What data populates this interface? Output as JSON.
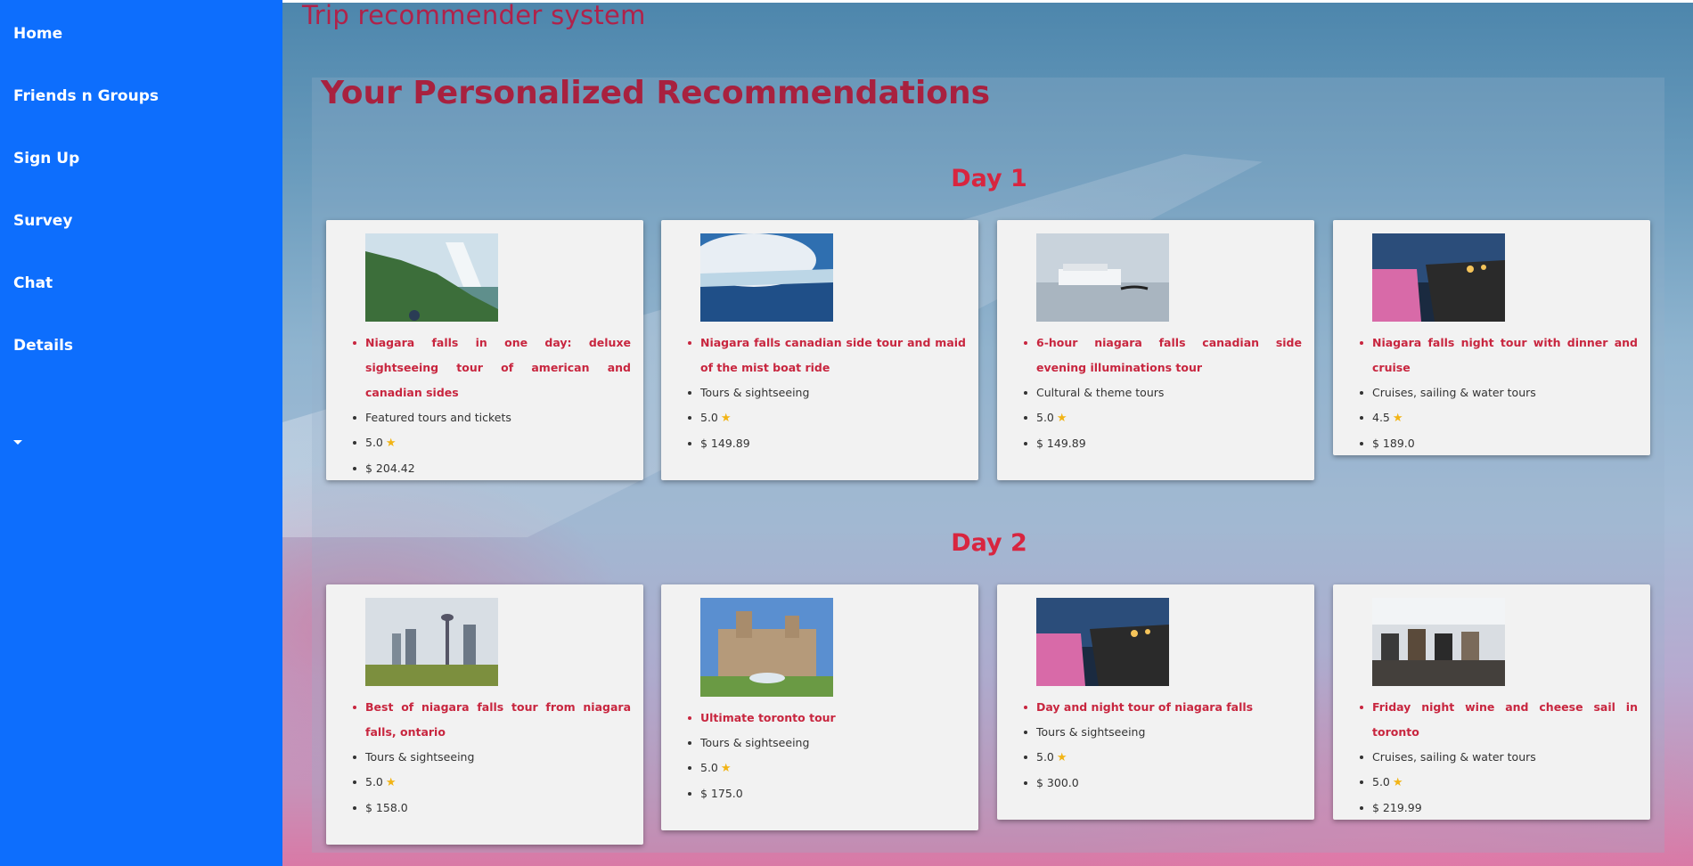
{
  "sidebar": {
    "items": [
      {
        "label": "Home"
      },
      {
        "label": "Friends n Groups"
      },
      {
        "label": "Sign Up"
      },
      {
        "label": "Survey"
      },
      {
        "label": "Chat"
      },
      {
        "label": "Details"
      }
    ],
    "dropdown_icon": "caret-down-icon"
  },
  "header": {
    "title": "Trip recommender system"
  },
  "main": {
    "heading": "Your Personalized Recommendations",
    "days": [
      {
        "label": "Day 1",
        "cards": [
          {
            "name": "Niagara falls in one day: deluxe sightseeing tour of american and canadian sides",
            "category": "Featured tours and tickets",
            "rating": "5.0",
            "price": "$ 204.42"
          },
          {
            "name": "Niagara falls canadian side tour and maid of the mist boat ride",
            "category": "Tours & sightseeing",
            "rating": "5.0",
            "price": "$ 149.89"
          },
          {
            "name": "6-hour niagara falls canadian side evening illuminations tour",
            "category": "Cultural & theme tours",
            "rating": "5.0",
            "price": "$ 149.89"
          },
          {
            "name": "Niagara falls night tour with dinner and cruise",
            "category": "Cruises, sailing & water tours",
            "rating": "4.5",
            "price": "$ 189.0"
          }
        ]
      },
      {
        "label": "Day 2",
        "cards": [
          {
            "name": "Best of niagara falls tour from niagara falls, ontario",
            "category": "Tours & sightseeing",
            "rating": "5.0",
            "price": "$ 158.0"
          },
          {
            "name": "Ultimate toronto tour",
            "category": "Tours & sightseeing",
            "rating": "5.0",
            "price": "$ 175.0"
          },
          {
            "name": "Day and night tour of niagara falls",
            "category": "Tours & sightseeing",
            "rating": "5.0",
            "price": "$ 300.0"
          },
          {
            "name": "Friday night wine and cheese sail in toronto",
            "category": "Cruises, sailing & water tours",
            "rating": "5.0",
            "price": "$ 219.99"
          }
        ]
      }
    ],
    "star_icon": "star-icon",
    "colors": {
      "accent": "#0d6efd",
      "title": "#a8213f",
      "day": "#d8253f",
      "link": "#c8263f",
      "star": "#f2b415"
    }
  }
}
